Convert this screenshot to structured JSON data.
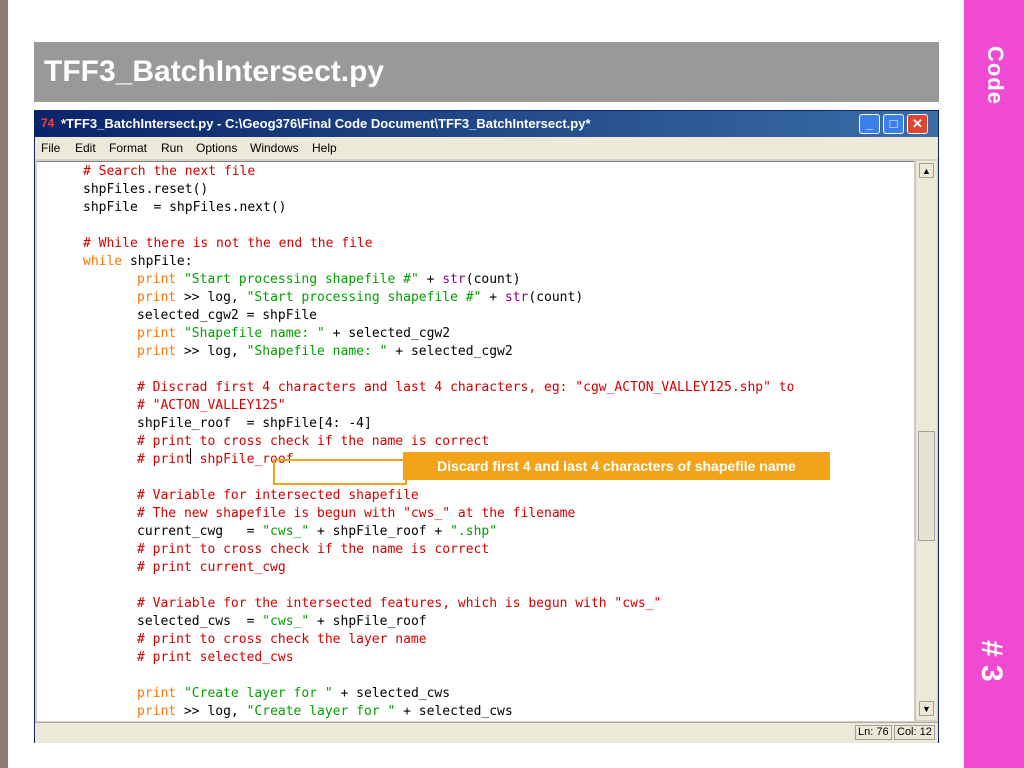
{
  "slide": {
    "title": "TFF3_BatchIntersect.py",
    "section": "Code",
    "number": "# 3",
    "accent_color": "#f04ad2",
    "title_bar_color": "#999999"
  },
  "window": {
    "title": "*TFF3_BatchIntersect.py - C:\\Geog376\\Final Code Document\\TFF3_BatchIntersect.py*",
    "icon": "python-idle-icon",
    "controls": {
      "minimize": "minimize-icon",
      "maximize": "maximize-icon",
      "close": "close-icon"
    }
  },
  "menu": [
    "File",
    "Edit",
    "Format",
    "Run",
    "Options",
    "Windows",
    "Help"
  ],
  "code_lines": [
    {
      "tokens": [
        {
          "t": "# Search the next file",
          "c": "comment"
        }
      ],
      "indent": 80
    },
    {
      "tokens": [
        {
          "t": "shpFiles.reset()",
          "c": "plain"
        }
      ],
      "indent": 80
    },
    {
      "tokens": [
        {
          "t": "shpFile  = shpFiles.next()",
          "c": "plain"
        }
      ],
      "indent": 80
    },
    {
      "tokens": [],
      "indent": 80
    },
    {
      "tokens": [
        {
          "t": "# While there is not the end the file",
          "c": "comment"
        }
      ],
      "indent": 80
    },
    {
      "tokens": [
        {
          "t": "while",
          "c": "keyword"
        },
        {
          "t": " shpFile:",
          "c": "plain"
        }
      ],
      "indent": 80
    },
    {
      "tokens": [
        {
          "t": "print",
          "c": "keyword"
        },
        {
          "t": " ",
          "c": "plain"
        },
        {
          "t": "\"Start processing shapefile #\"",
          "c": "string"
        },
        {
          "t": " + ",
          "c": "plain"
        },
        {
          "t": "str",
          "c": "builtin"
        },
        {
          "t": "(count)",
          "c": "plain"
        }
      ],
      "indent": 134
    },
    {
      "tokens": [
        {
          "t": "print",
          "c": "keyword"
        },
        {
          "t": " >> log, ",
          "c": "plain"
        },
        {
          "t": "\"Start processing shapefile #\"",
          "c": "string"
        },
        {
          "t": " + ",
          "c": "plain"
        },
        {
          "t": "str",
          "c": "builtin"
        },
        {
          "t": "(count)",
          "c": "plain"
        }
      ],
      "indent": 134
    },
    {
      "tokens": [
        {
          "t": "selected_cgw2 = shpFile",
          "c": "plain"
        }
      ],
      "indent": 134
    },
    {
      "tokens": [
        {
          "t": "print",
          "c": "keyword"
        },
        {
          "t": " ",
          "c": "plain"
        },
        {
          "t": "\"Shapefile name: \"",
          "c": "string"
        },
        {
          "t": " + selected_cgw2",
          "c": "plain"
        }
      ],
      "indent": 134
    },
    {
      "tokens": [
        {
          "t": "print",
          "c": "keyword"
        },
        {
          "t": " >> log, ",
          "c": "plain"
        },
        {
          "t": "\"Shapefile name: \"",
          "c": "string"
        },
        {
          "t": " + selected_cgw2",
          "c": "plain"
        }
      ],
      "indent": 134
    },
    {
      "tokens": [],
      "indent": 134
    },
    {
      "tokens": [
        {
          "t": "# Discrad first 4 characters and last 4 characters, eg: \"cgw_ACTON_VALLEY125.shp\" to",
          "c": "comment"
        }
      ],
      "indent": 134
    },
    {
      "tokens": [
        {
          "t": "# \"ACTON_VALLEY125\"",
          "c": "comment"
        }
      ],
      "indent": 134
    },
    {
      "tokens": [
        {
          "t": "shpFile_roof  = shpFile[4: -4]",
          "c": "plain"
        }
      ],
      "indent": 134
    },
    {
      "tokens": [
        {
          "t": "# print to cross check if the name is correct",
          "c": "comment"
        }
      ],
      "indent": 134
    },
    {
      "tokens": [
        {
          "t": "# print shpFile_roof",
          "c": "comment"
        }
      ],
      "indent": 134
    },
    {
      "tokens": [],
      "indent": 134
    },
    {
      "tokens": [
        {
          "t": "# Variable for intersected shapefile",
          "c": "comment"
        }
      ],
      "indent": 134
    },
    {
      "tokens": [
        {
          "t": "# The new shapefile is begun with \"cws_\" at the filename",
          "c": "comment"
        }
      ],
      "indent": 134
    },
    {
      "tokens": [
        {
          "t": "current_cwg   = ",
          "c": "plain"
        },
        {
          "t": "\"cws_\"",
          "c": "string"
        },
        {
          "t": " + shpFile_roof + ",
          "c": "plain"
        },
        {
          "t": "\".shp\"",
          "c": "string"
        }
      ],
      "indent": 134
    },
    {
      "tokens": [
        {
          "t": "# print to cross check if the name is correct",
          "c": "comment"
        }
      ],
      "indent": 134
    },
    {
      "tokens": [
        {
          "t": "# print current_cwg",
          "c": "comment"
        }
      ],
      "indent": 134
    },
    {
      "tokens": [],
      "indent": 134
    },
    {
      "tokens": [
        {
          "t": "# Variable for the intersected features, which is begun with \"cws_\"",
          "c": "comment"
        }
      ],
      "indent": 134
    },
    {
      "tokens": [
        {
          "t": "selected_cws  = ",
          "c": "plain"
        },
        {
          "t": "\"cws_\"",
          "c": "string"
        },
        {
          "t": " + shpFile_roof",
          "c": "plain"
        }
      ],
      "indent": 134
    },
    {
      "tokens": [
        {
          "t": "# print to cross check the layer name",
          "c": "comment"
        }
      ],
      "indent": 134
    },
    {
      "tokens": [
        {
          "t": "# print selected_cws",
          "c": "comment"
        }
      ],
      "indent": 134
    },
    {
      "tokens": [],
      "indent": 134
    },
    {
      "tokens": [
        {
          "t": "print",
          "c": "keyword"
        },
        {
          "t": " ",
          "c": "plain"
        },
        {
          "t": "\"Create layer for \"",
          "c": "string"
        },
        {
          "t": " + selected_cws",
          "c": "plain"
        }
      ],
      "indent": 134
    },
    {
      "tokens": [
        {
          "t": "print",
          "c": "keyword"
        },
        {
          "t": " >> log, ",
          "c": "plain"
        },
        {
          "t": "\"Create layer for \"",
          "c": "string"
        },
        {
          "t": " + selected_cws",
          "c": "plain"
        }
      ],
      "indent": 134
    }
  ],
  "callout": {
    "text": "Discard first 4 and last 4 characters of shapefile name",
    "color": "#f3a31a"
  },
  "scrollbar": {
    "up_icon": "scroll-up-arrow-icon",
    "down_icon": "scroll-down-arrow-icon"
  },
  "status": {
    "line": "Ln: 76",
    "col": "Col: 12"
  },
  "colors": {
    "comment": "#d40000",
    "keyword": "#ff7700",
    "string": "#00a000",
    "builtin": "#900090"
  }
}
